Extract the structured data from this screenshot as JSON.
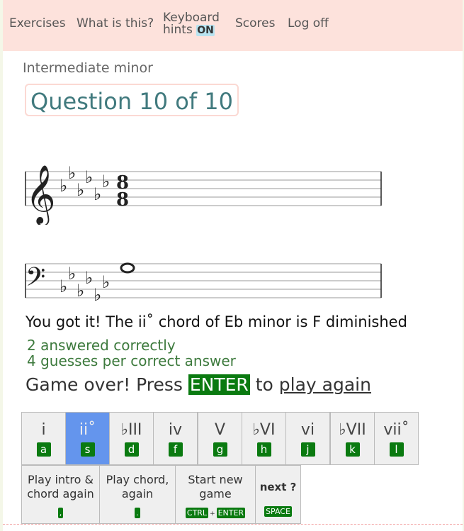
{
  "nav": {
    "exercises": "Exercises",
    "what_is_this": "What is this?",
    "keyboard_line1": "Keyboard",
    "keyboard_line2": "hints",
    "keyboard_state": "ON",
    "scores": "Scores",
    "logoff": "Log off"
  },
  "exercise_title": "Intermediate minor",
  "question_label": "Question 10 of 10",
  "feedback": {
    "result": "You got it! The ii˚ chord of Eb minor is F diminished",
    "correct_count": "2 answered correctly",
    "guesses": "4 guesses per correct answer",
    "game_over_prefix": "Game over! Press",
    "enter_key": "ENTER",
    "game_over_middle": "to",
    "play_again": "play again"
  },
  "chord_buttons": [
    {
      "label": "i",
      "key": "a"
    },
    {
      "label": "ii˚",
      "key": "s"
    },
    {
      "label": "♭III",
      "key": "d"
    },
    {
      "label": "iv",
      "key": "f"
    },
    {
      "label": "V",
      "key": "g"
    },
    {
      "label": "♭VI",
      "key": "h"
    },
    {
      "label": "vi",
      "key": "j"
    },
    {
      "label": "♭VII",
      "key": "k"
    },
    {
      "label": "vii˚",
      "key": "l"
    }
  ],
  "selected_chord": "ii˚",
  "actions": {
    "play_intro_line1": "Play intro &",
    "play_intro_line2": "chord again",
    "play_intro_key": ",",
    "play_chord_line1": "Play chord,",
    "play_chord_line2": "again",
    "play_chord_key": ".",
    "start_new_line1": "Start new",
    "start_new_line2": "game",
    "start_new_key1": "CTRL",
    "start_new_key_plus": "+",
    "start_new_key2": "ENTER",
    "next_label": "next ?",
    "next_key": "SPACE"
  },
  "notation": {
    "key_signature": "Eb minor (6 flats)",
    "time_signature_top": "8",
    "time_signature_bottom": "8",
    "treble_clef_glyph": "𝄞",
    "bass_clef_glyph": "𝄢",
    "flat_glyph": "♭"
  },
  "colors": {
    "nav_bg": "#fde2dc",
    "key_badge": "#0a7a10",
    "selected_button": "#6495ed",
    "question_text": "#417a7e",
    "stats_text": "#3d7a3d"
  }
}
